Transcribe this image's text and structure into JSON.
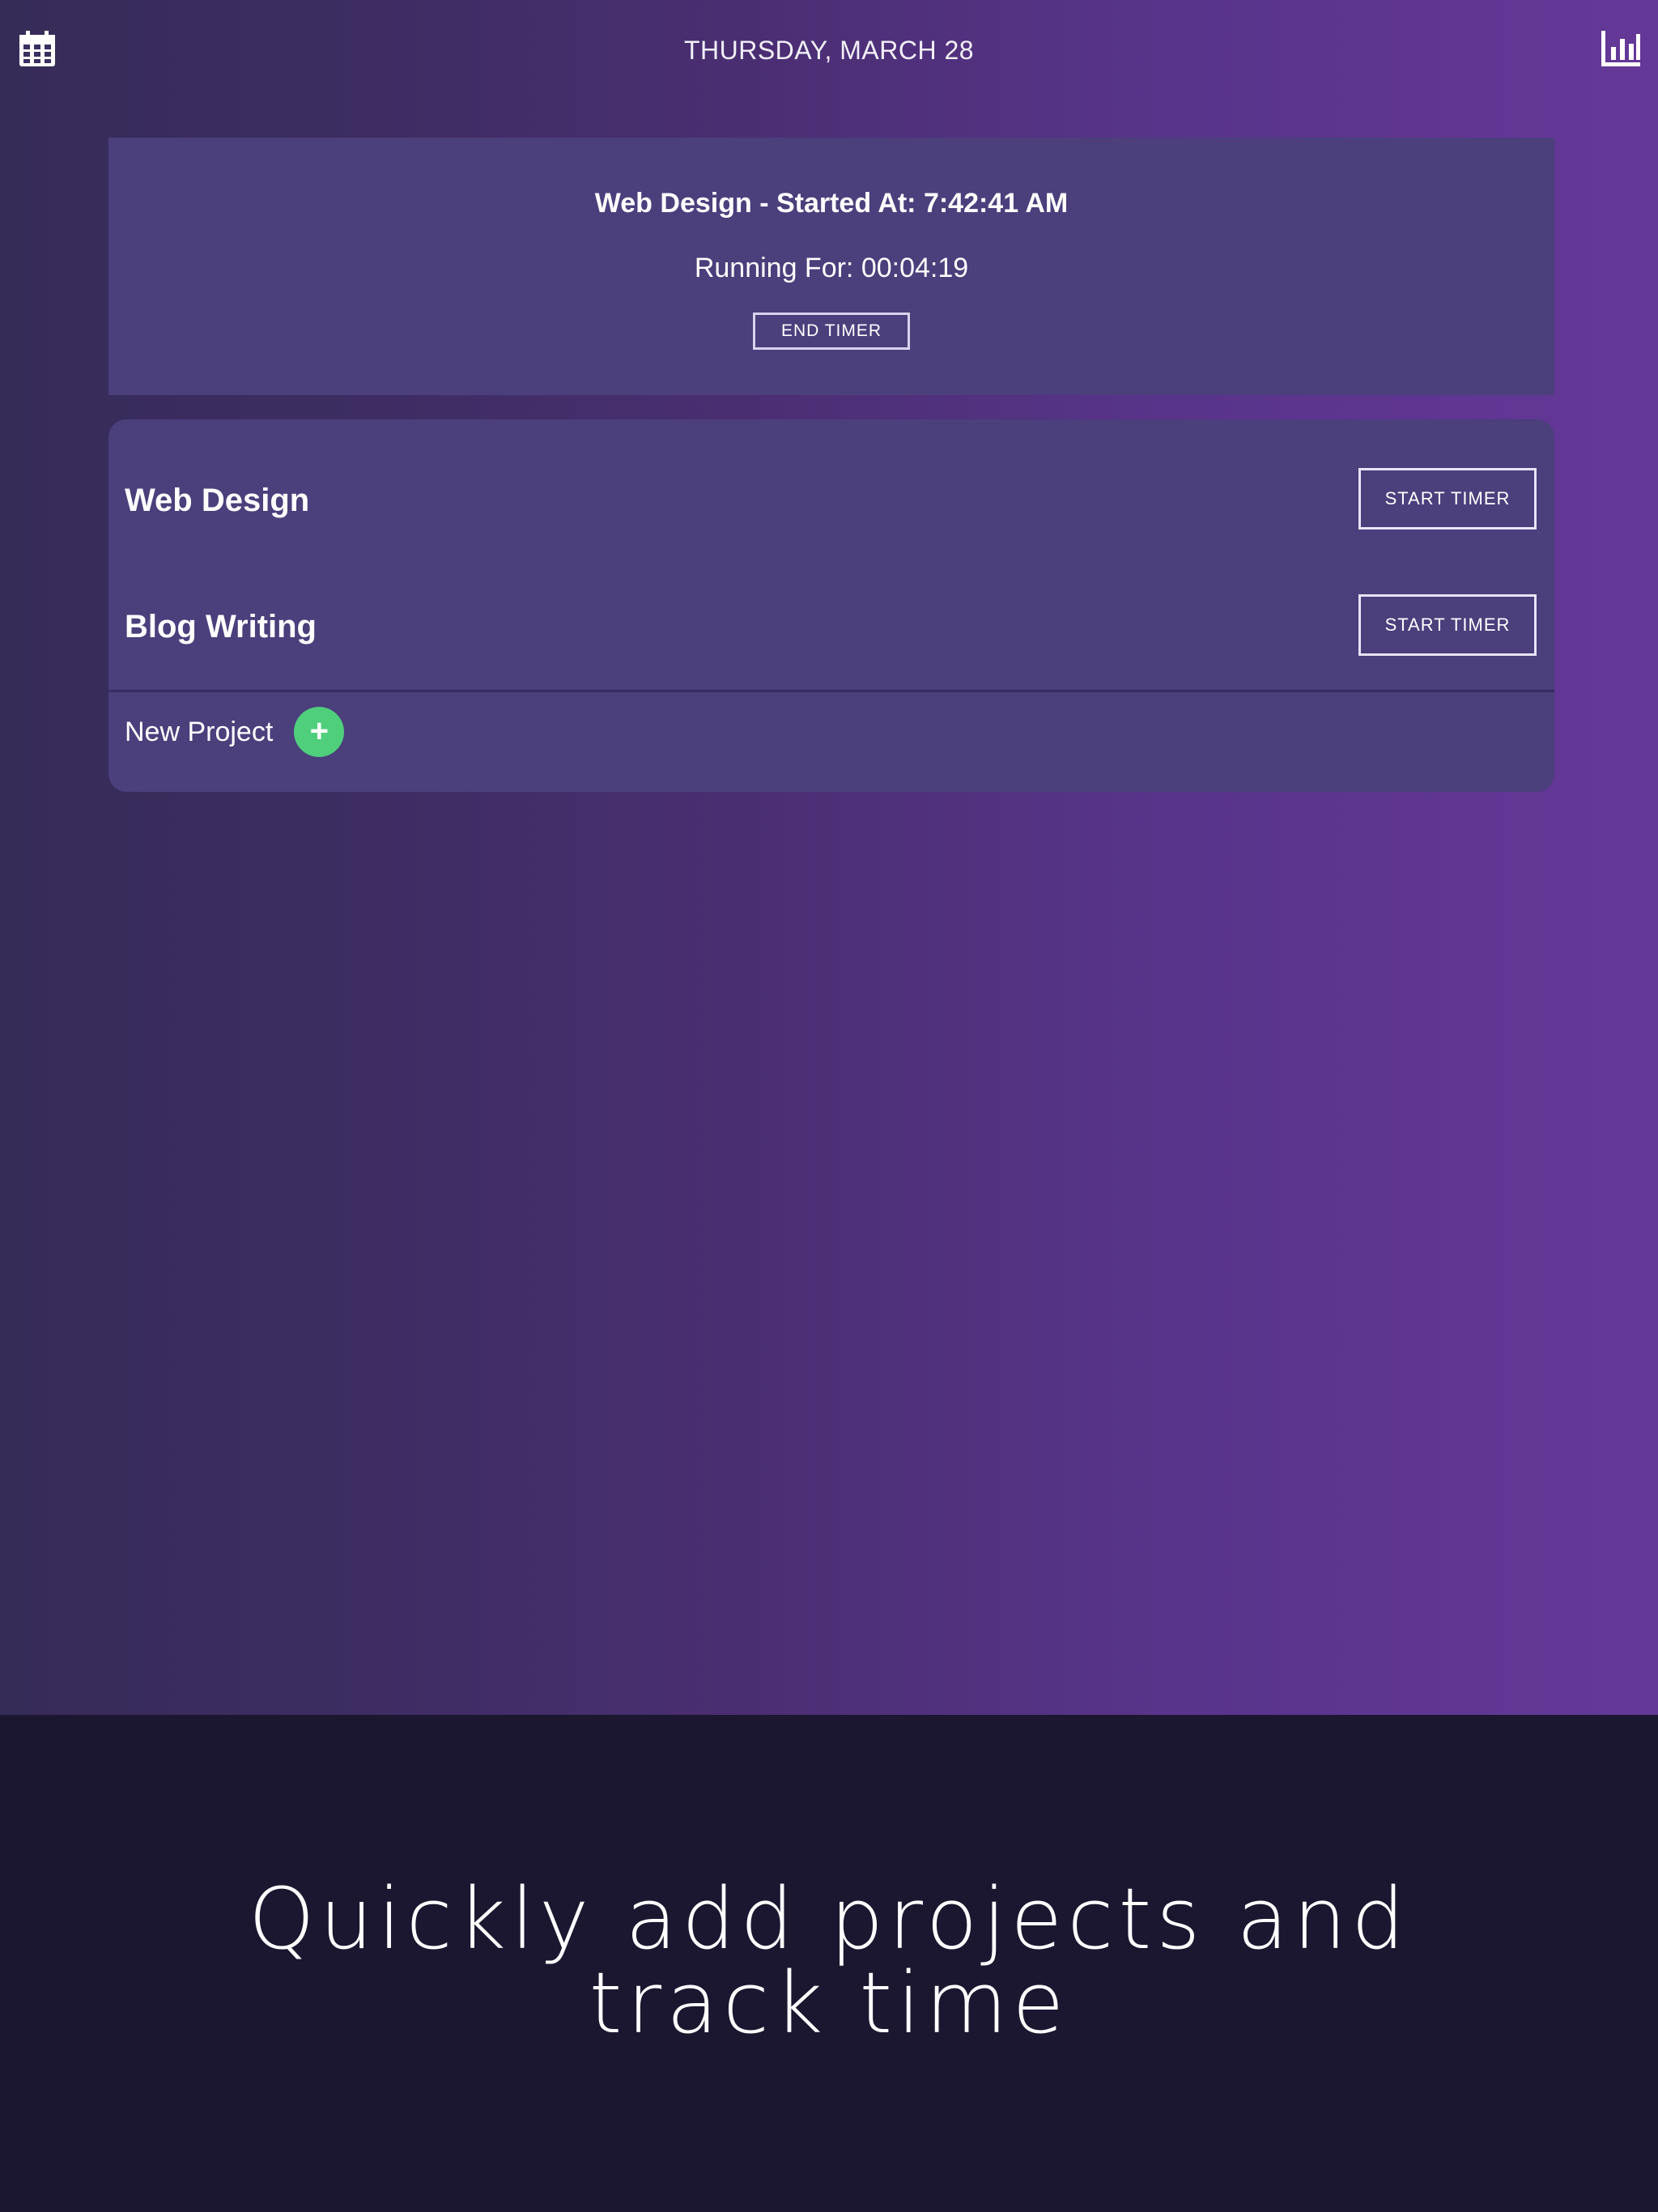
{
  "header": {
    "date": "THURSDAY, MARCH 28",
    "left_icon": "calendar-icon",
    "right_icon": "bar-chart-icon"
  },
  "active_timer": {
    "title": "Web Design - Started At: 7:42:41 AM",
    "running": "Running For: 00:04:19",
    "end_label": "END TIMER"
  },
  "projects": [
    {
      "name": "Web Design",
      "button_label": "START TIMER"
    },
    {
      "name": "Blog Writing",
      "button_label": "START TIMER"
    }
  ],
  "new_project": {
    "label": "New Project",
    "add_symbol": "+"
  },
  "caption": {
    "line1": "Quickly add projects and",
    "line2": "track time"
  },
  "colors": {
    "gradient_start": "#362c58",
    "gradient_end": "#643898",
    "card": "#4b3f7c",
    "add_button": "#4fcf7b",
    "caption_bg": "#1c1730"
  }
}
